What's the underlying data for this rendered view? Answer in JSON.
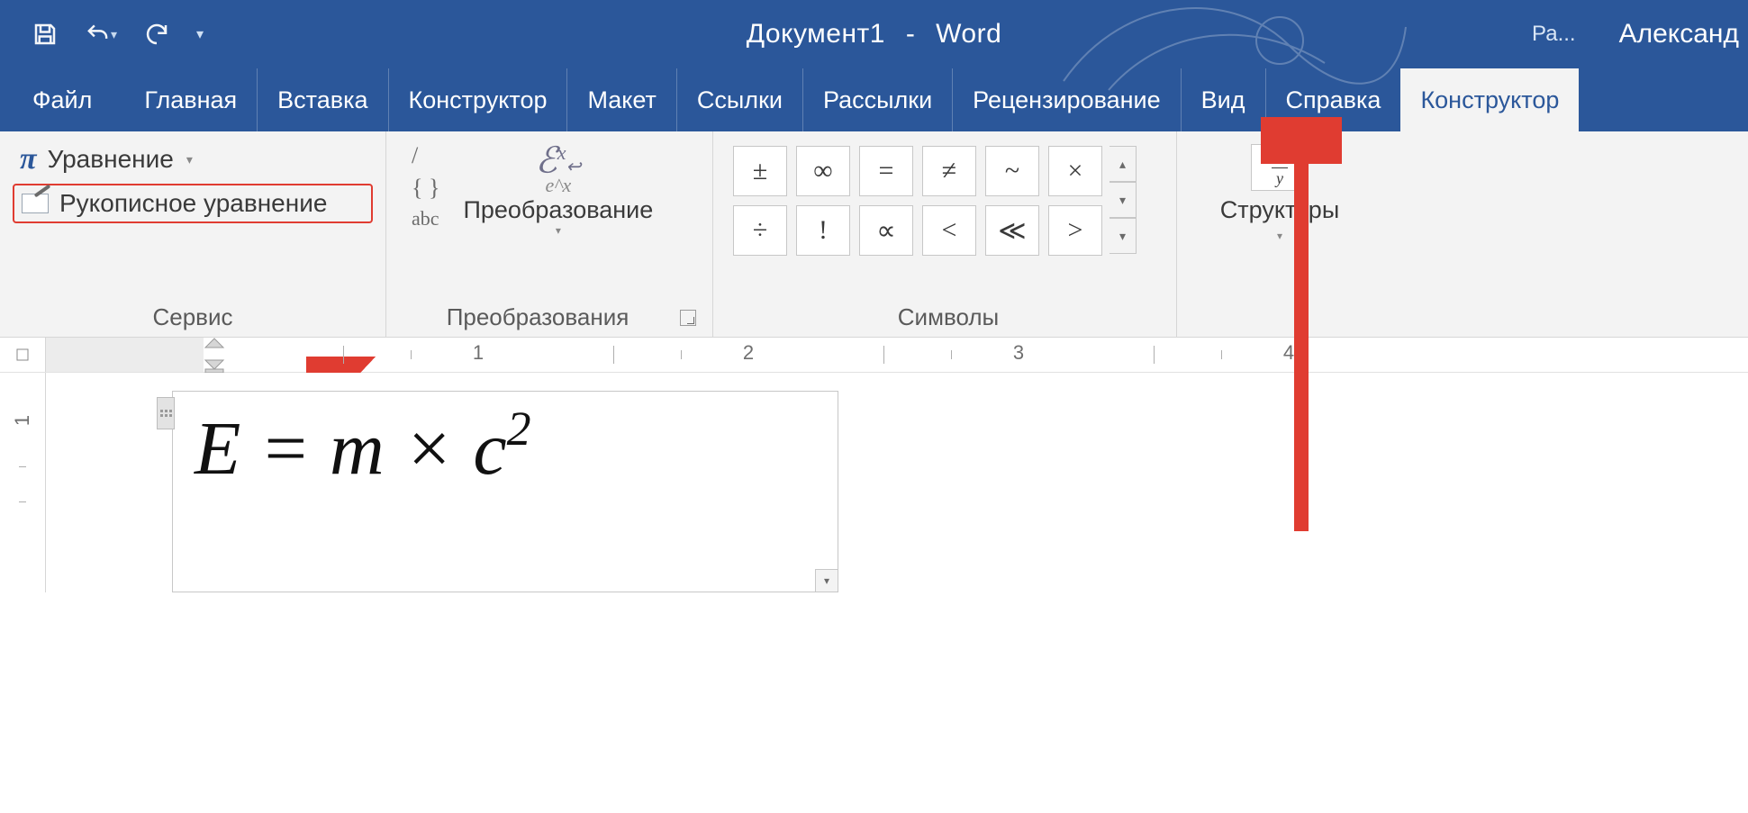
{
  "titlebar": {
    "doc_name": "Документ1",
    "app_name": "Word",
    "contextual_group": "Ра...",
    "user_name": "Александ"
  },
  "tabs": {
    "file": "Файл",
    "items": [
      "Главная",
      "Вставка",
      "Конструктор",
      "Макет",
      "Ссылки",
      "Рассылки",
      "Рецензирование",
      "Вид",
      "Справка"
    ],
    "active": "Конструктор"
  },
  "ribbon": {
    "tools": {
      "equation": "Уравнение",
      "ink_equation": "Рукописное уравнение",
      "group_label": "Сервис"
    },
    "conversions": {
      "linear": "abc",
      "convert_label": "Преобразование",
      "group_label": "Преобразования"
    },
    "symbols": {
      "row1": [
        "±",
        "∞",
        "=",
        "≠",
        "~",
        "×"
      ],
      "row2": [
        "÷",
        "!",
        "∝",
        "<",
        "≪",
        ">"
      ],
      "group_label": "Символы"
    },
    "structures": {
      "button_label": "Структуры"
    }
  },
  "ruler": {
    "numbers": [
      "1",
      "2",
      "3",
      "4"
    ]
  },
  "v_ruler": {
    "n1": "1"
  },
  "document": {
    "equation_html": "E = m × c",
    "equation_sup": "2"
  }
}
